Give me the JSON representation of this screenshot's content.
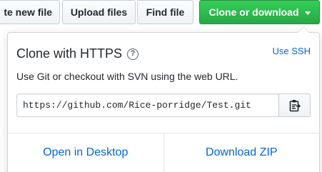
{
  "toolbar": {
    "create_label": "te new file",
    "upload_label": "Upload files",
    "find_label": "Find file",
    "clone_label": "Clone or download",
    "clone_color": "#28a745"
  },
  "clone_panel": {
    "title": "Clone with HTTPS",
    "help_glyph": "?",
    "use_ssh_label": "Use SSH",
    "description": "Use Git or checkout with SVN using the web URL.",
    "url": "https://github.com/Rice-porridge/Test.git",
    "copy_icon": "clipboard-icon",
    "open_desktop_label": "Open in Desktop",
    "download_zip_label": "Download ZIP",
    "link_color": "#0366d6"
  }
}
